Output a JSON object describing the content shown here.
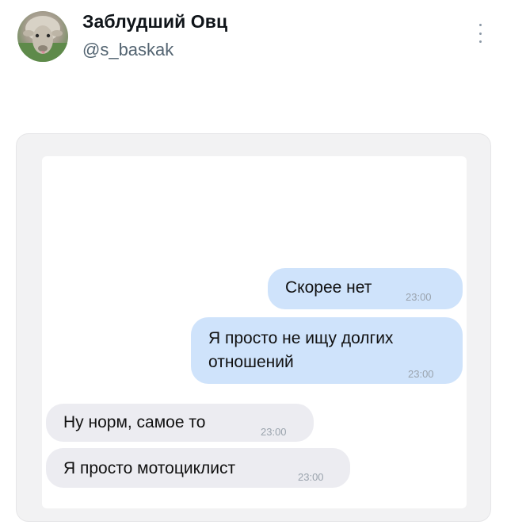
{
  "author": {
    "name": "Заблудший Овц",
    "handle": "@s_baskak",
    "avatar_icon": "sheep-avatar-icon"
  },
  "menu": {
    "icon": "more-vertical-icon"
  },
  "chat": {
    "colors": {
      "outgoing_bubble": "#cfe3fb",
      "incoming_bubble": "#ececf1"
    },
    "messages": [
      {
        "direction": "outgoing",
        "text": "Скорее нет",
        "time": "23:00"
      },
      {
        "direction": "outgoing",
        "text": "Я просто не ищу долгих отношений",
        "time": "23:00"
      },
      {
        "direction": "incoming",
        "text": "Ну норм, самое то",
        "time": "23:00"
      },
      {
        "direction": "incoming",
        "text": "Я просто мотоциклист",
        "time": "23:00"
      }
    ]
  }
}
